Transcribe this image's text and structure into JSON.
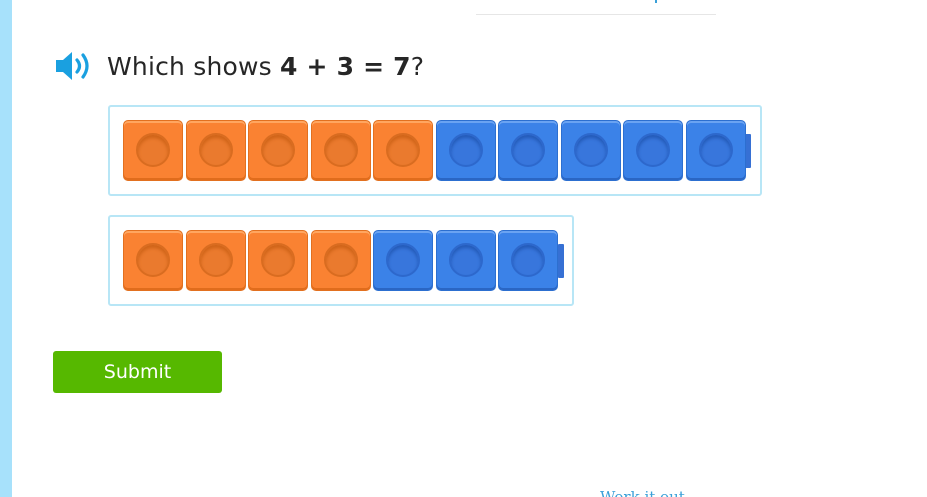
{
  "question": {
    "prefix": "Which shows ",
    "equation": "4 + 3 = 7",
    "suffix": "?",
    "speaker_icon": "speaker-icon"
  },
  "options": [
    {
      "id": "option-a",
      "orange_count": 5,
      "blue_count": 5
    },
    {
      "id": "option-b",
      "orange_count": 4,
      "blue_count": 3
    }
  ],
  "submit": {
    "label": "Submit"
  },
  "footer": {
    "partial_link_text": "Work it out"
  },
  "colors": {
    "orange_cube": "#fa8232",
    "blue_cube": "#3b82e8",
    "submit_bg": "#56b800",
    "option_border": "#b8e6f6",
    "accent_blue": "#1aa0e0"
  }
}
